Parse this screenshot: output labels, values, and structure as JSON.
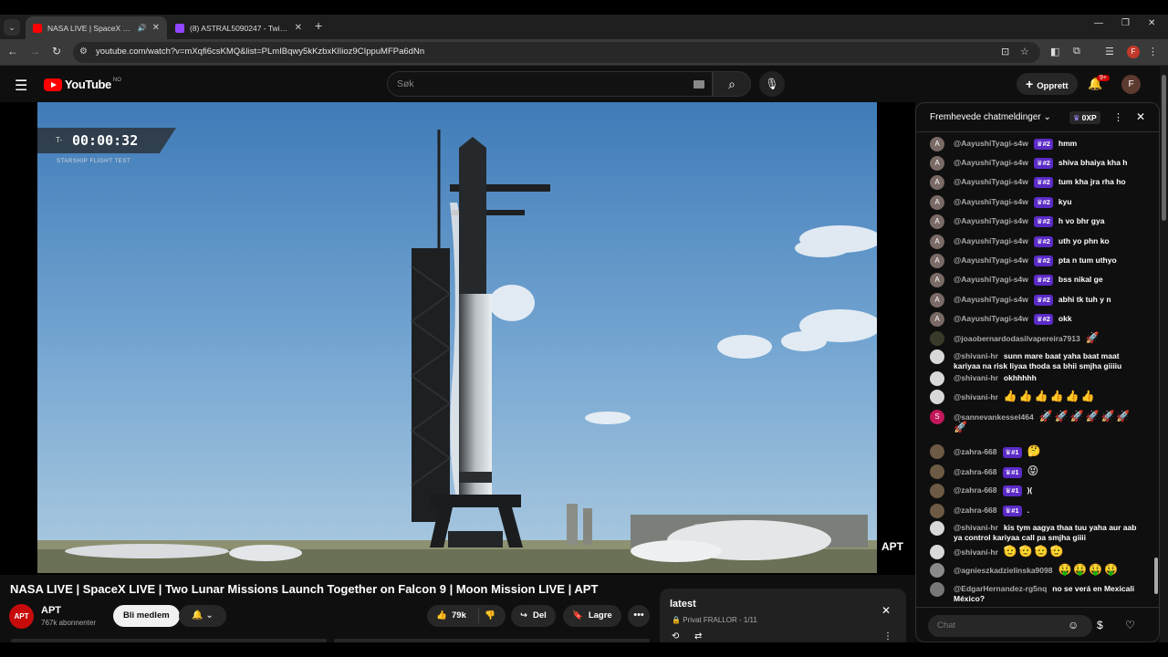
{
  "browser": {
    "tabs": [
      {
        "title": "NASA LIVE | SpaceX LIVE | T",
        "active": true,
        "favicon_color": "#ff0000"
      },
      {
        "title": "(8) ASTRAL5090247 - Twitch",
        "active": false,
        "favicon_color": "#9146ff"
      }
    ],
    "url": "youtube.com/watch?v=mXqfi6csKMQ&list=PLmIBqwy5kKzbxKlIioz9CIppuMFPa6dNn",
    "profile_initial": "F"
  },
  "masthead": {
    "logo_text": "YouTube",
    "country_code": "NO",
    "search_placeholder": "Søk",
    "create_label": "Opprett",
    "notifications": "9+",
    "avatar_initial": "F"
  },
  "video": {
    "timer_prefix": "T-",
    "timer": "00:00:32",
    "overlay_subtitle": "STARSHIP FLIGHT TEST",
    "watermark": "APT",
    "title": "NASA LIVE | SpaceX LIVE | Two Lunar Missions Launch Together on Falcon 9 | Moon Mission LIVE | APT",
    "channel_avatar": "APT",
    "channel_name": "APT",
    "subscribers": "767k abonnenter",
    "join_label": "Bli medlem",
    "likes": "79k",
    "share_label": "Del",
    "save_label": "Lagre"
  },
  "playlist": {
    "title": "latest",
    "subtitle": "Privat FRALLOR - 1/11"
  },
  "chat": {
    "header": "Fremhevede chatmeldinger",
    "xp": "0XP",
    "input_placeholder": "Chat",
    "messages": [
      {
        "author": "@AayushiTyagi-s4w",
        "badge": "#2",
        "text": "hmm",
        "avatar": "A",
        "avatar_color": "#7a6a66"
      },
      {
        "author": "@AayushiTyagi-s4w",
        "badge": "#2",
        "text": "shiva bhaiya kha h",
        "avatar": "A",
        "avatar_color": "#7a6a66"
      },
      {
        "author": "@AayushiTyagi-s4w",
        "badge": "#2",
        "text": "tum kha jra rha ho",
        "avatar": "A",
        "avatar_color": "#7a6a66"
      },
      {
        "author": "@AayushiTyagi-s4w",
        "badge": "#2",
        "text": "kyu",
        "avatar": "A",
        "avatar_color": "#7a6a66"
      },
      {
        "author": "@AayushiTyagi-s4w",
        "badge": "#2",
        "text": "h vo bhr gya",
        "avatar": "A",
        "avatar_color": "#7a6a66"
      },
      {
        "author": "@AayushiTyagi-s4w",
        "badge": "#2",
        "text": "uth yo phn ko",
        "avatar": "A",
        "avatar_color": "#7a6a66"
      },
      {
        "author": "@AayushiTyagi-s4w",
        "badge": "#2",
        "text": "pta n tum uthyo",
        "avatar": "A",
        "avatar_color": "#7a6a66"
      },
      {
        "author": "@AayushiTyagi-s4w",
        "badge": "#2",
        "text": "bss nikal ge",
        "avatar": "A",
        "avatar_color": "#7a6a66"
      },
      {
        "author": "@AayushiTyagi-s4w",
        "badge": "#2",
        "text": "abhi tk tuh y n",
        "avatar": "A",
        "avatar_color": "#7a6a66"
      },
      {
        "author": "@AayushiTyagi-s4w",
        "badge": "#2",
        "text": "okk",
        "avatar": "A",
        "avatar_color": "#7a6a66"
      },
      {
        "author": "@joaobernardodasilvapereira7913",
        "badge": "",
        "text": "🚀",
        "avatar": "",
        "avatar_color": "#3a3a2a"
      },
      {
        "author": "@shivani-hr",
        "badge": "",
        "text": "sunn mare baat yaha baat maat kariyaa na risk liyaa thoda sa bhii smjha giiiiu",
        "avatar": "",
        "avatar_color": "#d8d8d8"
      },
      {
        "author": "@shivani-hr",
        "badge": "",
        "text": "okhhhhh",
        "avatar": "",
        "avatar_color": "#d8d8d8"
      },
      {
        "author": "@shivani-hr",
        "badge": "",
        "text": "👍👍👍👍👍👍",
        "avatar": "",
        "avatar_color": "#d8d8d8"
      },
      {
        "author": "@sannevankessel464",
        "badge": "",
        "text": "🚀🚀🚀🚀🚀🚀🚀",
        "avatar": "S",
        "avatar_color": "#c2185b"
      },
      {
        "author": "@zahra-668",
        "badge": "#1",
        "text": "🤔",
        "avatar": "",
        "avatar_color": "#6d5a44"
      },
      {
        "author": "@zahra-668",
        "badge": "#1",
        "text": "😝",
        "avatar": "",
        "avatar_color": "#6d5a44"
      },
      {
        "author": "@zahra-668",
        "badge": "#1",
        "text": ")(",
        "avatar": "",
        "avatar_color": "#6d5a44"
      },
      {
        "author": "@zahra-668",
        "badge": "#1",
        "text": ".",
        "avatar": "",
        "avatar_color": "#6d5a44"
      },
      {
        "author": "@shivani-hr",
        "badge": "",
        "text": "kis tym aagya thaa tuu yaha aur aab ya control kariyaa call pa smjha giiii",
        "avatar": "",
        "avatar_color": "#d8d8d8"
      },
      {
        "author": "@shivani-hr",
        "badge": "",
        "text": "🫡🫡🫡🫡",
        "avatar": "",
        "avatar_color": "#d8d8d8"
      },
      {
        "author": "@agnieszkadzielinska9098",
        "badge": "",
        "text": "🤑🤑🤑🤑",
        "avatar": "",
        "avatar_color": "#8a8a8a"
      },
      {
        "author": "@EdgarHernandez-rg5nq",
        "badge": "",
        "text": "no se verá en Mexicali México?",
        "avatar": "",
        "avatar_color": "#777"
      }
    ]
  }
}
